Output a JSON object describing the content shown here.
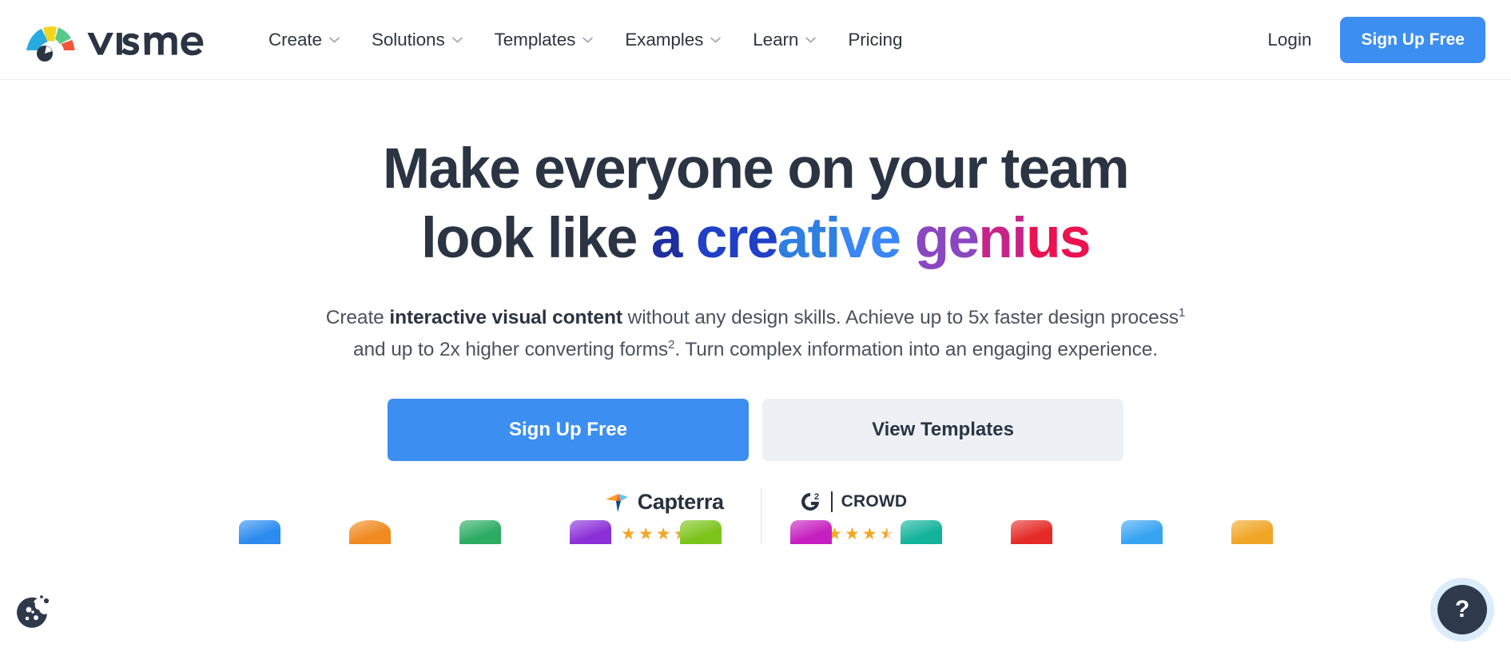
{
  "nav": {
    "brand_name": "visme",
    "links": [
      {
        "label": "Create",
        "has_dropdown": true
      },
      {
        "label": "Solutions",
        "has_dropdown": true
      },
      {
        "label": "Templates",
        "has_dropdown": true
      },
      {
        "label": "Examples",
        "has_dropdown": true
      },
      {
        "label": "Learn",
        "has_dropdown": true
      },
      {
        "label": "Pricing",
        "has_dropdown": false
      }
    ],
    "login_label": "Login",
    "signup_label": "Sign Up Free"
  },
  "hero": {
    "headline_line1": "Make everyone on your team",
    "headline_line2_plain": "look like ",
    "headline_parts": {
      "a": "a ",
      "cre": "cre",
      "ati": "ati",
      "ve": "ve ",
      "ge": "ge",
      "ni": "ni",
      "us": "us"
    },
    "subhead_1_pre": "Create ",
    "subhead_1_bold": "interactive visual content",
    "subhead_1_post": " without any design skills. Achieve up to 5x faster design process",
    "subhead_1_sup": "1",
    "subhead_2_pre": "and up to 2x higher converting forms",
    "subhead_2_sup": "2",
    "subhead_2_post": ". Turn complex information into an engaging experience.",
    "cta_primary": "Sign Up Free",
    "cta_secondary": "View Templates"
  },
  "badges": [
    {
      "name": "Capterra",
      "logo": "capterra-logo",
      "rating": 4.5,
      "stars_full": 4,
      "stars_half": 1
    },
    {
      "name": "CROWD",
      "prefix": "G",
      "superscript": "2",
      "logo": "g2-crowd-logo",
      "rating": 4.5,
      "stars_full": 4,
      "stars_half": 1
    }
  ],
  "icon_strip": [
    {
      "name": "presentation-icon",
      "color": "#2b8bef"
    },
    {
      "name": "orange-sphere-icon",
      "color": "#f08a21"
    },
    {
      "name": "document-icon",
      "color": "#2cab63"
    },
    {
      "name": "purple-card-icon",
      "color": "#8b30d8"
    },
    {
      "name": "chart-icon",
      "color": "#7bc41c"
    },
    {
      "name": "magenta-icon",
      "color": "#c51fc0"
    },
    {
      "name": "teal-list-icon",
      "color": "#12b39a"
    },
    {
      "name": "red-video-icon",
      "color": "#e52b28"
    },
    {
      "name": "blue-sparkle-icon",
      "color": "#37a4f2"
    },
    {
      "name": "amber-folder-icon",
      "color": "#f0a527"
    }
  ],
  "widgets": {
    "cookie_label": "cookie-preferences",
    "help_label": "?"
  },
  "colors": {
    "brand_blue": "#3c8ef0",
    "headline_dark": "#2b3443",
    "secondary_button": "#edf1f5",
    "star_gold": "#f5a623"
  },
  "star_glyph": "★"
}
